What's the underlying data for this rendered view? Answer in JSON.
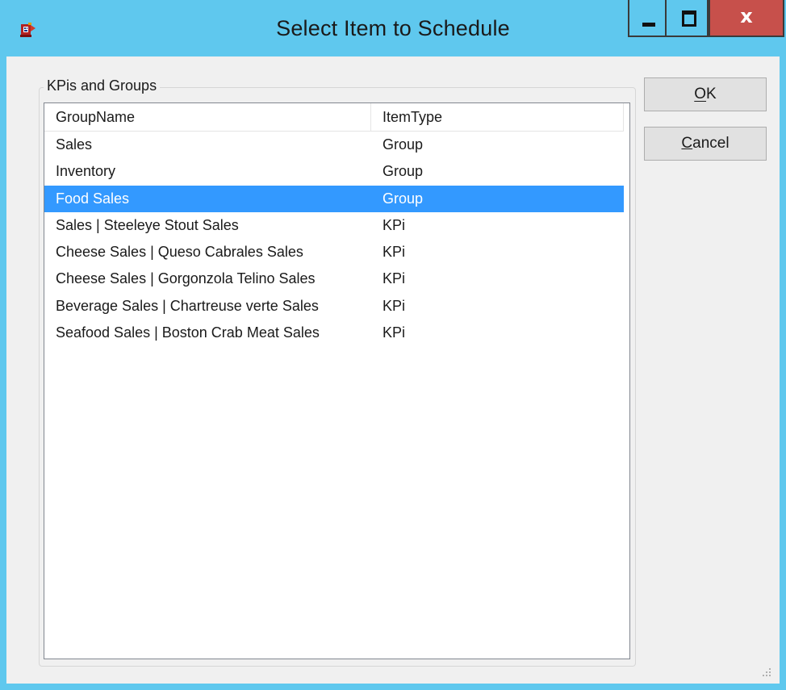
{
  "window": {
    "title": "Select Item to Schedule",
    "close_glyph": "x"
  },
  "colors": {
    "titlebar": "#5fc8ee",
    "close_button": "#c7504b",
    "selection": "#3399ff",
    "client": "#f0f0f0"
  },
  "icons": [
    "app-icon",
    "minimize-icon",
    "maximize-icon",
    "close-icon",
    "resize-grip-icon"
  ],
  "groupbox": {
    "label": "KPis and Groups"
  },
  "list": {
    "columns": [
      "GroupName",
      "ItemType"
    ],
    "rows": [
      {
        "name": "Sales",
        "type": "Group",
        "selected": false
      },
      {
        "name": "Inventory",
        "type": "Group",
        "selected": false
      },
      {
        "name": "Food Sales",
        "type": "Group",
        "selected": true
      },
      {
        "name": "Sales | Steeleye Stout Sales",
        "type": "KPi",
        "selected": false
      },
      {
        "name": "Cheese Sales | Queso Cabrales Sales",
        "type": "KPi",
        "selected": false
      },
      {
        "name": "Cheese Sales | Gorgonzola Telino Sales",
        "type": "KPi",
        "selected": false
      },
      {
        "name": "Beverage Sales | Chartreuse verte Sales",
        "type": "KPi",
        "selected": false
      },
      {
        "name": "Seafood Sales | Boston Crab Meat Sales",
        "type": "KPi",
        "selected": false
      }
    ]
  },
  "buttons": {
    "ok": "OK",
    "cancel": "Cancel"
  }
}
